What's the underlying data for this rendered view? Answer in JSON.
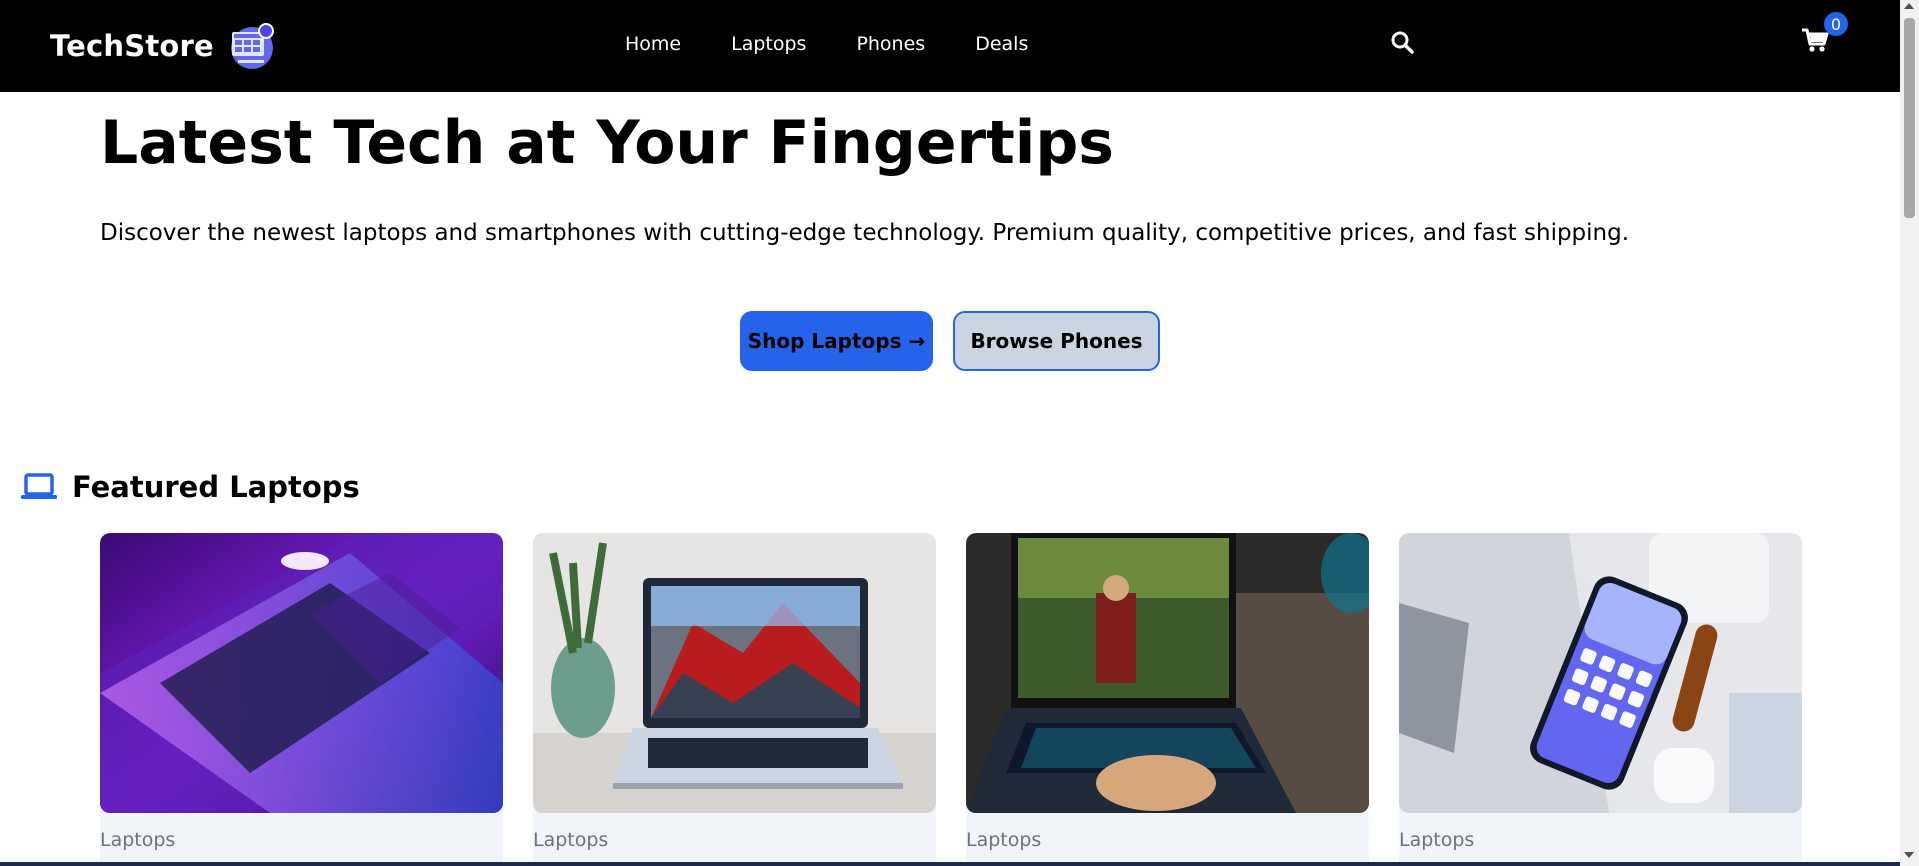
{
  "header": {
    "brand": "TechStore",
    "nav": [
      "Home",
      "Laptops",
      "Phones",
      "Deals"
    ],
    "cart_count": "0"
  },
  "hero": {
    "title": "Latest Tech at Your Fingertips",
    "subtitle": "Discover the newest laptops and smartphones with cutting-edge technology. Premium quality, competitive prices, and fast shipping.",
    "primary_button": "Shop Laptops →",
    "secondary_button": "Browse Phones"
  },
  "featured": {
    "title": "Featured Laptops",
    "icon": "laptop-icon",
    "products": [
      {
        "category": "Laptops",
        "image": "purple-laptop-photo"
      },
      {
        "category": "Laptops",
        "image": "macbook-desk-photo"
      },
      {
        "category": "Laptops",
        "image": "gaming-laptop-photo"
      },
      {
        "category": "Laptops",
        "image": "smartphone-flatlay-photo"
      }
    ]
  },
  "colors": {
    "accent": "#2563eb",
    "header_bg": "#000000",
    "secondary_btn": "#cbd5e1",
    "card_bg": "#f1f4f8"
  }
}
